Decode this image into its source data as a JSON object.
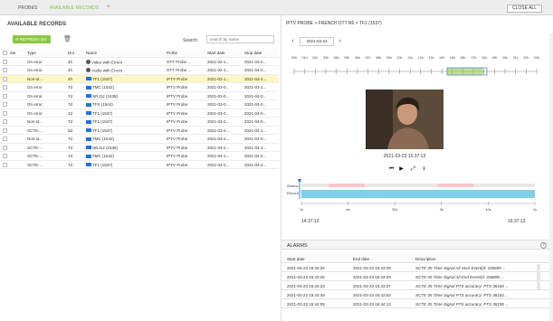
{
  "tabs": {
    "probes": "PROBES",
    "available": "AVAILABLE RECORDS",
    "close_tab": "×"
  },
  "close_all": "CLOSE ALL",
  "left_panel": {
    "title": "AVAILABLE RECORDS",
    "refresh": "REFRESH ON",
    "search_label": "Search:",
    "search_placeholder": "search by name",
    "columns": [
      "Sw",
      "Type",
      "Dur",
      "Name",
      "Probe",
      "Start date",
      "Stop date"
    ],
    "rows": [
      {
        "type": "On error",
        "dur": "4h",
        "name": "Video with Errors",
        "probe": "OTT Probe ...",
        "start": "2021-02-1...",
        "stop": "2021-03-2...",
        "icon": "globe"
      },
      {
        "type": "On error",
        "dur": "4h",
        "name": "Audio with Errors",
        "probe": "OTT Probe ...",
        "start": "2021-02-1...",
        "stop": "2021-04-2...",
        "icon": "globe"
      },
      {
        "type": "Non-st...",
        "dur": "4h",
        "name": "TF1 (1537)",
        "probe": "IPTV Probe",
        "start": "2021-02-1...",
        "stop": "2021-03-2...",
        "icon": "tv",
        "selected": true
      },
      {
        "type": "On error",
        "dur": "7d",
        "name": "TMC (1542)",
        "probe": "IPTV Probe",
        "start": "2021-03-0...",
        "stop": "2021-03-1...",
        "icon": "tv"
      },
      {
        "type": "On error",
        "dur": "7d",
        "name": "NRJ12 (1538)",
        "probe": "IPTV Probe",
        "start": "2021-03-0...",
        "stop": "2021-04-0...",
        "icon": "tv"
      },
      {
        "type": "On error",
        "dur": "7d",
        "name": "TFX (1544)",
        "probe": "IPTV Probe",
        "start": "2021-03-0...",
        "stop": "2021-04-0...",
        "icon": "tv"
      },
      {
        "type": "On error",
        "dur": "2d",
        "name": "TF1 (1537)",
        "probe": "IPTV Probe",
        "start": "2021-03-2...",
        "stop": "2021-04-0...",
        "icon": "tv"
      },
      {
        "type": "Non-st...",
        "dur": "7d",
        "name": "TF1 (1537)",
        "probe": "IPTV Probe",
        "start": "2021-03-2...",
        "stop": "2021-04-0...",
        "icon": "tv"
      },
      {
        "type": "SCTE-...",
        "dur": "5d",
        "name": "TF1 (1537)",
        "probe": "IPTV Probe",
        "start": "2021-03-2...",
        "stop": "2021-04-1...",
        "icon": "tv"
      },
      {
        "type": "Non-st...",
        "dur": "7d",
        "name": "TMC (1542)",
        "probe": "IPTV Probe",
        "start": "2021-03-2...",
        "stop": "2021-04-0...",
        "icon": "tv"
      },
      {
        "type": "SCTE-...",
        "dur": "7d",
        "name": "NRJ12 (1538)",
        "probe": "IPTV Probe",
        "start": "2021-03-2...",
        "stop": "2021-04-1...",
        "icon": "tv"
      },
      {
        "type": "SCTE-...",
        "dur": "7d",
        "name": "TMC (1542)",
        "probe": "IPTV Probe",
        "start": "2021-04-1...",
        "stop": "2021-04-2...",
        "icon": "tv"
      },
      {
        "type": "SCTE-...",
        "dur": "7d",
        "name": "TF1 (1537)",
        "probe": "IPTV Probe",
        "start": "2021-04-2...",
        "stop": "2021-04-2...",
        "icon": "tv"
      }
    ]
  },
  "right_panel": {
    "breadcrumb": "IPTV PROBE > FRENCH DTT R6 > TF1 (1537)",
    "date": "2021-03-23",
    "hours": [
      "00h",
      "01h",
      "02h",
      "03h",
      "04h",
      "05h",
      "06h",
      "07h",
      "08h",
      "09h",
      "10h",
      "11h",
      "12h",
      "13h",
      "14h",
      "15h",
      "16h",
      "17h",
      "18h",
      "19h",
      "20h",
      "21h",
      "22h",
      "23h"
    ],
    "video_time": "2021-03-23 15:37:13",
    "bar_labels": {
      "alarms": "Alarms",
      "record": "Record"
    },
    "zoom_ticks": [
      "1h",
      "4m",
      "30s",
      "3s",
      "10s",
      "1h"
    ],
    "time_left": "14:37:13",
    "time_right": "16:37:13",
    "colors": {
      "accent": "#8cc63f",
      "record": "#7fd0e8",
      "alarm_mark": "#e05050",
      "selected_row": "#fdf6c8"
    }
  },
  "alarms": {
    "title": "ALARMS",
    "columns": [
      "Start date",
      "End date",
      "Description"
    ],
    "rows": [
      {
        "start": "2021-03-23 15:43:25",
        "end": "2021-03-23 15:43:29",
        "desc": "SCTE-35 Time Signal All Start Event(d: 345609 ..."
      },
      {
        "start": "2021-03-23 15:43:25",
        "end": "2021-03-23 15:43:29",
        "desc": "SCTE-35 Time Signal All End Event(d: 3s8898 ..."
      },
      {
        "start": "2021-03-23 15:43:33",
        "end": "2021-03-23 15:43:37",
        "desc": "SCTE-35 Time Signal PTS accuracy: PTS 38166 ..."
      },
      {
        "start": "2021-03-23 15:43:49",
        "end": "2021-03-23 15:43:53",
        "desc": "SCTE-35 Time Signal PTS accuracy: PTS 38183 ..."
      },
      {
        "start": "2021-03-23 15:44:09",
        "end": "2021-03-23 15:44:13",
        "desc": "SCTE-35 Time Signal PTS accuracy: PTS 38198 ..."
      }
    ]
  }
}
